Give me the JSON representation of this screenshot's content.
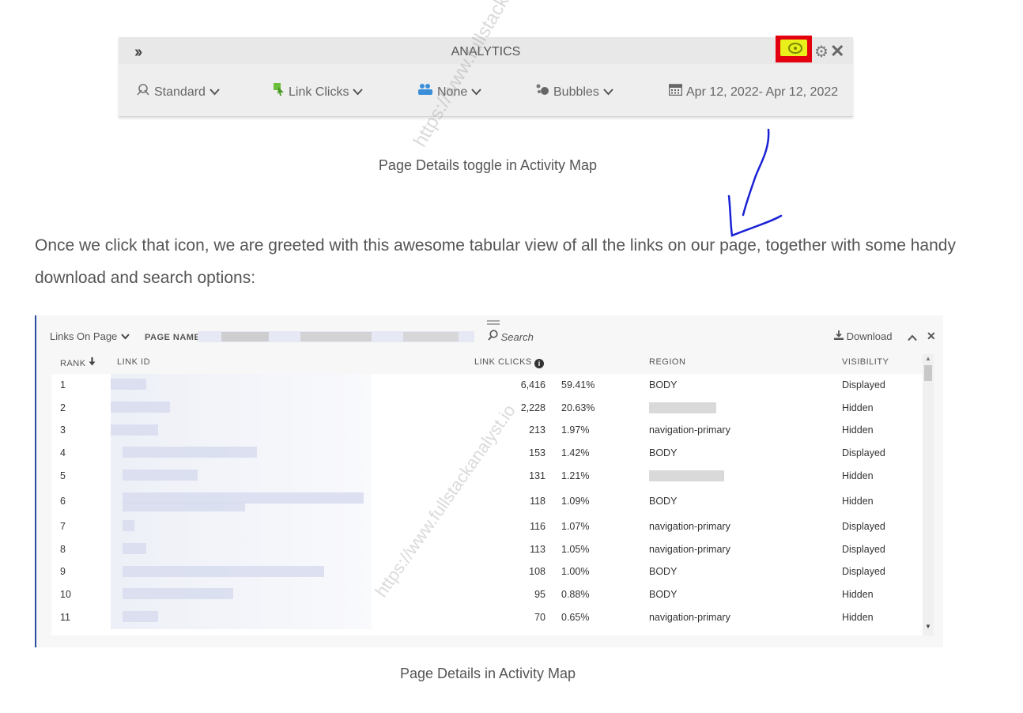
{
  "toolbar": {
    "expand_icon": "double-chevron-right",
    "title": "ANALYTICS",
    "selectors": [
      {
        "icon": "segment-icon",
        "label": "Standard"
      },
      {
        "icon": "link-click-icon",
        "label": "Link Clicks"
      },
      {
        "icon": "people-icon",
        "label": "None"
      },
      {
        "icon": "bubbles-icon",
        "label": "Bubbles"
      },
      {
        "icon": "calendar-icon",
        "label": "Apr 12, 2022- Apr 12, 2022"
      }
    ]
  },
  "caption1": "Page Details toggle in Activity Map",
  "paragraph": "Once we click that icon, we are greeted with this awesome tabular view of all the links on our page, together with some handy download and search options:",
  "panel": {
    "selector_label": "Links On Page",
    "page_name_label": "PAGE NAME",
    "search_placeholder": "Search",
    "download_label": "Download",
    "columns": {
      "rank": "RANK",
      "link_id": "LINK ID",
      "link_clicks": "LINK CLICKS",
      "region": "REGION",
      "visibility": "VISIBILITY"
    },
    "rows": [
      {
        "rank": "1",
        "clicks": "6,416",
        "pct": "59.41%",
        "region": "BODY",
        "visibility": "Displayed"
      },
      {
        "rank": "2",
        "clicks": "2,228",
        "pct": "20.63%",
        "region": "",
        "visibility": "Hidden"
      },
      {
        "rank": "3",
        "clicks": "213",
        "pct": "1.97%",
        "region": "navigation-primary",
        "visibility": "Hidden"
      },
      {
        "rank": "4",
        "clicks": "153",
        "pct": "1.42%",
        "region": "BODY",
        "visibility": "Displayed"
      },
      {
        "rank": "5",
        "clicks": "131",
        "pct": "1.21%",
        "region": "",
        "visibility": "Hidden"
      },
      {
        "rank": "6",
        "clicks": "118",
        "pct": "1.09%",
        "region": "BODY",
        "visibility": "Hidden"
      },
      {
        "rank": "7",
        "clicks": "116",
        "pct": "1.07%",
        "region": "navigation-primary",
        "visibility": "Displayed"
      },
      {
        "rank": "8",
        "clicks": "113",
        "pct": "1.05%",
        "region": "navigation-primary",
        "visibility": "Displayed"
      },
      {
        "rank": "9",
        "clicks": "108",
        "pct": "1.00%",
        "region": "BODY",
        "visibility": "Displayed"
      },
      {
        "rank": "10",
        "clicks": "95",
        "pct": "0.88%",
        "region": "BODY",
        "visibility": "Hidden"
      },
      {
        "rank": "11",
        "clicks": "70",
        "pct": "0.65%",
        "region": "navigation-primary",
        "visibility": "Hidden"
      }
    ]
  },
  "caption2": "Page Details in Activity Map",
  "watermark": "https://www.fullstackanalyst.io",
  "colors": {
    "highlight_box": "#e3000f",
    "eye_background": "#e9ef1a",
    "annotation_arrow": "#1a22d6",
    "panel_border": "#2b4f9e"
  }
}
